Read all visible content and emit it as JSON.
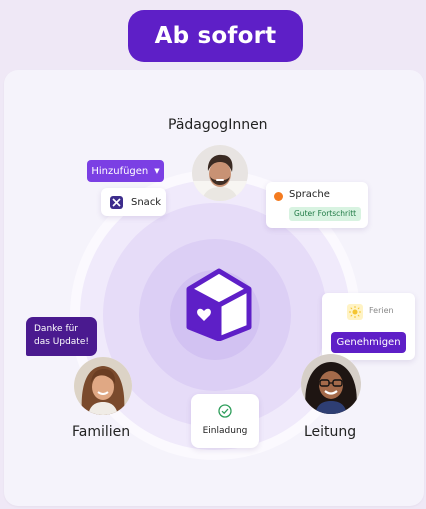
{
  "header": {
    "badge_label": "Ab sofort"
  },
  "roles": {
    "top": "PädagogInnen",
    "left": "Familien",
    "right": "Leitung"
  },
  "add_dropdown": {
    "label": "Hinzufügen"
  },
  "snack_chip": {
    "label": "Snack"
  },
  "language_chip": {
    "title": "Sprache",
    "badge": "Guter Fortschritt"
  },
  "vacation_card": {
    "title": "Ferien",
    "button": "Genehmigen"
  },
  "message_bubble": {
    "text_line1": "Danke für",
    "text_line2": "das Update!"
  },
  "invite_chip": {
    "label": "Einladung"
  },
  "colors": {
    "brand": "#5e1fc7",
    "accent": "#7b3fe4",
    "orange": "#f47b20",
    "success_green": "#2e9e5b",
    "sun_yellow": "#f4c430"
  }
}
